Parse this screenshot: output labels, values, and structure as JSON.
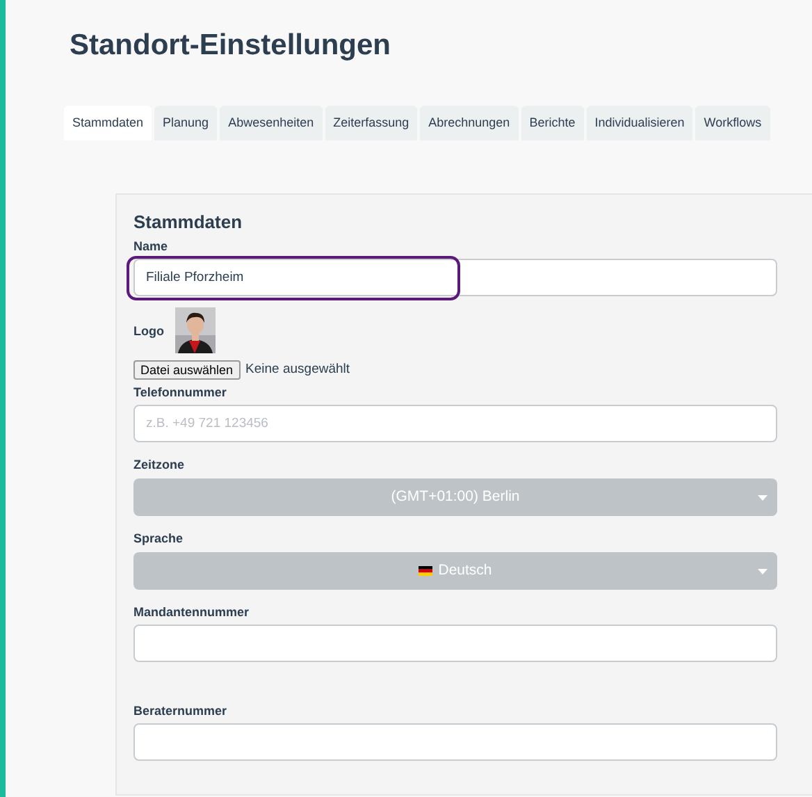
{
  "page": {
    "title": "Standort-Einstellungen"
  },
  "tabs": [
    {
      "label": "Stammdaten",
      "selected": true
    },
    {
      "label": "Planung",
      "selected": false
    },
    {
      "label": "Abwesenheiten",
      "selected": false
    },
    {
      "label": "Zeiterfassung",
      "selected": false
    },
    {
      "label": "Abrechnungen",
      "selected": false
    },
    {
      "label": "Berichte",
      "selected": false
    },
    {
      "label": "Individualisieren",
      "selected": false
    },
    {
      "label": "Workflows",
      "selected": false
    }
  ],
  "panel": {
    "heading": "Stammdaten",
    "fields": [
      {
        "kind": "text",
        "label": "Name",
        "value": "Filiale Pforzheim",
        "highlighted": true
      },
      {
        "kind": "logo",
        "label": "Logo",
        "file_button": "Datei auswählen",
        "file_status": "Keine ausgewählt"
      },
      {
        "kind": "text",
        "label": "Telefonnummer",
        "placeholder": "z.B. +49 721 123456"
      },
      {
        "kind": "select",
        "label": "Zeitzone",
        "value": "(GMT+01:00) Berlin"
      },
      {
        "kind": "select",
        "label": "Sprache",
        "value": "Deutsch",
        "flag": true
      },
      {
        "kind": "text",
        "label": "Mandantennummer"
      },
      {
        "kind": "spacer"
      },
      {
        "kind": "text",
        "label": "Beraternummer"
      }
    ]
  }
}
